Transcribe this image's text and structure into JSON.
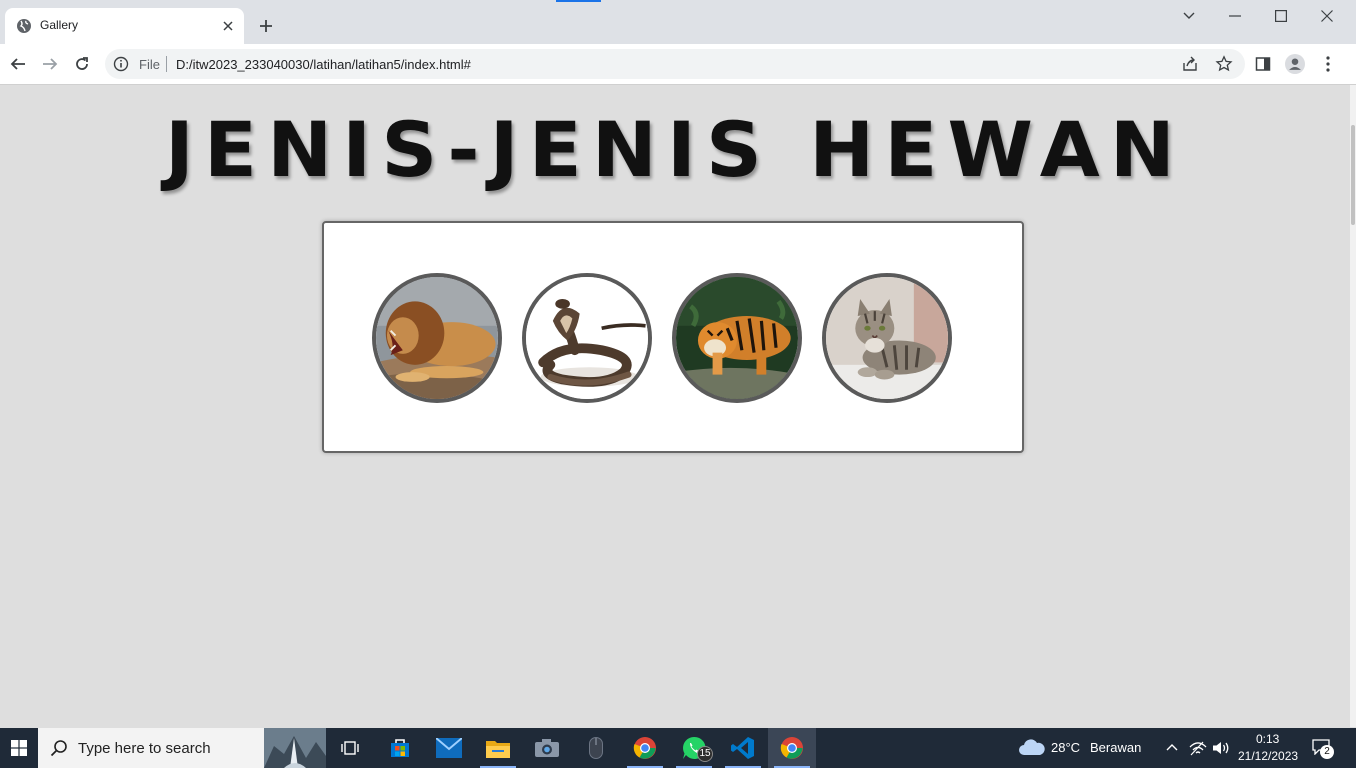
{
  "browser": {
    "tab": {
      "title": "Gallery",
      "favicon": "globe-icon"
    },
    "address": {
      "scheme": "File",
      "url": "D:/itw2023_233040030/latihan/latihan5/index.html#"
    }
  },
  "page": {
    "heading": "JENIS-JENIS HEWAN",
    "gallery": [
      {
        "animal": "lion",
        "icon": "lion-photo"
      },
      {
        "animal": "cobra",
        "icon": "cobra-photo"
      },
      {
        "animal": "tiger",
        "icon": "tiger-photo"
      },
      {
        "animal": "cat",
        "icon": "cat-photo"
      }
    ]
  },
  "taskbar": {
    "search_placeholder": "Type here to search",
    "whatsapp_badge": "15",
    "weather": {
      "temp": "28°C",
      "condition": "Berawan"
    },
    "clock": {
      "time": "0:13",
      "date": "21/12/2023"
    },
    "notifications": "2"
  },
  "colors": {
    "page_bg": "#dedede",
    "frame_border": "#5a5a5a",
    "taskbar_bg": "#1f2a38",
    "accent": "#1a73e8"
  }
}
